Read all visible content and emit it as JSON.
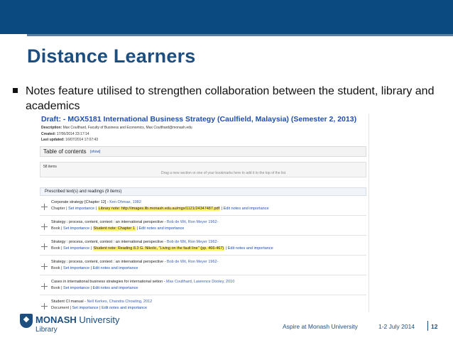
{
  "slide": {
    "title": "Distance Learners",
    "bullet": "Notes feature utilised to strengthen collaboration between the student, library and academics"
  },
  "screenshot": {
    "draft_title": "Draft: - MGX5181 International Business Strategy (Caulfield, Malaysia) (Semester 2, 2013)",
    "meta": [
      {
        "label": "Description:",
        "value": "Max Coulthard, Faculty of Business and Economics, Max Coulthard@monash.edu"
      },
      {
        "label": "Created:",
        "value": "17/06/2014 23:17:14"
      },
      {
        "label": "Last updated:",
        "value": "16/07/2014 17:07:43"
      }
    ],
    "toc_label": "Table of contents",
    "toc_show": "[show]",
    "items_count": "58 items",
    "drag_hint": "Drag a new section or one of your bookmarks here to add it to the top of the list",
    "section_label": "Prescribed text(s) and readings (9 items)",
    "entries": [
      {
        "title": "Corporate strategy [Chapter 12] - ",
        "by": "Ken Ohmae, 1982",
        "type": "Chapter",
        "imp": "Set importance",
        "note_label": "Library note:",
        "note": "http://images.lib.monash.edu.au/mgx/1121/24347487.pdf",
        "edit": "Edit notes and importance",
        "highlight": true
      },
      {
        "title": "Strategy : process, content, context : an international perspective - ",
        "by": "Bob de Wit, Ron Meyer 1962-",
        "type": "Book",
        "imp": "Set importance",
        "note_label": "Student note:",
        "note": "Chapter 1",
        "edit": "Edit notes and importance",
        "highlight": true
      },
      {
        "title": "Strategy : process, content, context : an international perspective - ",
        "by": "Bob de Wit, Ron Meyer 1962-",
        "type": "Book",
        "imp": "Set importance",
        "note_label": "Student note:",
        "note": "Reading 8.3 G. Nikolic, \"Living on the fault line\" (pp. 466-467)",
        "edit": "Edit notes and importance",
        "highlight": true
      },
      {
        "title": "Strategy : process, content, context : an international perspective - ",
        "by": "Bob de Wit, Ron Meyer 1962-",
        "type": "Book",
        "imp": "Set importance",
        "note_label": "",
        "note": "",
        "edit": "Edit notes and importance",
        "highlight": false
      },
      {
        "title": "Cases in international business strategies for international setion - ",
        "by": "Max Coulthard, Lawrence Dooley, 2010",
        "type": "Book",
        "imp": "Set importance",
        "note_label": "",
        "note": "",
        "edit": "Edit notes and importance",
        "highlight": false
      },
      {
        "title": "Student CI manual - ",
        "by": "Nell Kerkes, Chandra Chowling, 2012",
        "type": "Document",
        "imp": "Set importance",
        "note_label": "",
        "note": "",
        "edit": "Edit notes and importance",
        "highlight": false
      }
    ]
  },
  "footer": {
    "logo_word_bold": "MONASH",
    "logo_word_rest": " University",
    "logo_sub": "Library",
    "center": "Aspire at Monash University",
    "date": "1-2 July 2014",
    "page": "12"
  },
  "colors": {
    "brand_blue": "#0b4a80",
    "title_blue": "#1d4e80",
    "highlight": "#fff36b"
  }
}
